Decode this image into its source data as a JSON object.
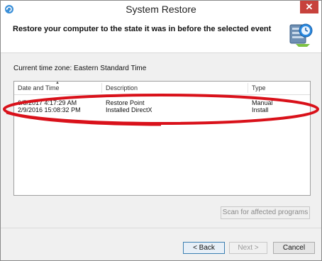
{
  "window": {
    "title": "System Restore",
    "close_glyph": "✕"
  },
  "header": {
    "text": "Restore your computer to the state it was in before the selected event",
    "icon": "system-restore-icon"
  },
  "timezone_label": "Current time zone: Eastern Standard Time",
  "table": {
    "columns": [
      "Date and Time",
      "Description",
      "Type"
    ],
    "sort_column": "Date and Time",
    "rows": [
      {
        "date": "6/5/2017 4:17:29 AM",
        "description": "Restore Point",
        "type": "Manual",
        "highlighted": true
      },
      {
        "date": "2/9/2016 15:08:32 PM",
        "description": "Installed DirectX",
        "type": "Install",
        "highlighted": false
      }
    ]
  },
  "buttons": {
    "scan": "Scan for affected programs",
    "back": "< Back",
    "next": "Next >",
    "cancel": "Cancel"
  },
  "colors": {
    "annotation_red": "#d9111a",
    "close_red": "#c7423c",
    "focus_blue": "#3c7fb1"
  }
}
